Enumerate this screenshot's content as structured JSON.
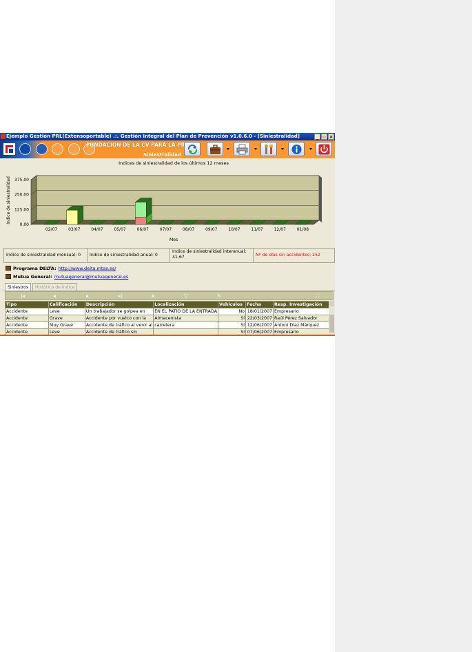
{
  "window": {
    "title": "Ejemplo Gestión PRL(Extensoportable) .:. Gestión Integral del Plan de Prevención v1.0.6.0 - [Siniestralidad]",
    "buttons": [
      "_",
      "▫",
      "×"
    ]
  },
  "toolbar": {
    "org_name": "FUNDACION DE LA CV PARA LA PRL",
    "module": "Siniestralidad",
    "accent_color": "#f7922a",
    "icons": [
      "refresh-icon",
      "briefcase-icon",
      "print-icon",
      "tools-icon",
      "info-icon",
      "power-icon"
    ]
  },
  "chart_data": {
    "type": "bar",
    "title": "Indices de siniestralidad de los últimos 12 meses",
    "xlabel": "Mes",
    "ylabel": "Indice de siniestralidad",
    "ylim": [
      0,
      375
    ],
    "yticks": [
      "375,00",
      "250,00",
      "125,00",
      "0,00"
    ],
    "ytick_values": [
      375,
      250,
      125,
      0
    ],
    "categories": [
      "02/07",
      "03/07",
      "04/07",
      "05/07",
      "06/07",
      "07/07",
      "08/07",
      "09/07",
      "10/07",
      "11/07",
      "12/07",
      "01/08"
    ],
    "series": [
      {
        "color": "#f08080",
        "values": [
          0,
          0,
          0,
          0,
          62,
          0,
          0,
          0,
          0,
          0,
          0,
          0
        ]
      },
      {
        "color": "#98f098",
        "values": [
          0,
          0,
          0,
          0,
          125,
          0,
          0,
          0,
          0,
          0,
          0,
          0
        ]
      },
      {
        "color": "#ffff99",
        "values": [
          0,
          120,
          0,
          0,
          0,
          0,
          0,
          0,
          0,
          0,
          0,
          0
        ]
      }
    ],
    "grid": true,
    "legend": "none"
  },
  "stats": {
    "monthly": "Indice de siniestralidad mensual: 0",
    "annual": "Indice de siniestralidad anual: 0",
    "interannual_label": "Indice de siniestralidad interanual:",
    "interannual_value": "41,67",
    "days_without": "Nº de días sin accidentes: 252",
    "days_color": "#ff0000"
  },
  "links": {
    "delta_label": "Programa DELTA:",
    "delta_url": "http://www.delta.mtas.es/",
    "mutua_label": "Mutua General:",
    "mutua_email": "mutuageneral@mutuageneral.es"
  },
  "tabs": [
    {
      "label": "Siniestros",
      "active": true
    },
    {
      "label": "Histórico de índice",
      "active": false
    }
  ],
  "navigator": [
    "|◂",
    "◂",
    "▸",
    "▸|",
    "+",
    "▽",
    "✎",
    "⛶"
  ],
  "grid": {
    "columns": [
      "Tipo",
      "Calificación",
      "Descripción",
      "Localización",
      "Vehículos",
      "Fecha",
      "Resp. Investigación"
    ],
    "rows": [
      [
        "Accidente",
        "Leve",
        "Un trabajador se golpea en",
        "EN EL PATIO DE LA ENTRADA",
        "No",
        "18/01/2007",
        "Empresario"
      ],
      [
        "Accidente",
        "Grave",
        "Accidente por vuelco con la",
        "Almacenista",
        "Sí",
        "22/03/2007",
        "Raúl Pérez Salvador"
      ],
      [
        "Accidente",
        "Muy Grave",
        "Accidente de tráfico al venir al",
        "carretera",
        "Sí",
        "12/06/2007",
        "Antoni Díaz Márquez"
      ],
      [
        "Accidente",
        "Leve",
        "Accidente de tráfico sin",
        "",
        "Sí",
        "07/06/2007",
        "Empresario"
      ]
    ]
  }
}
